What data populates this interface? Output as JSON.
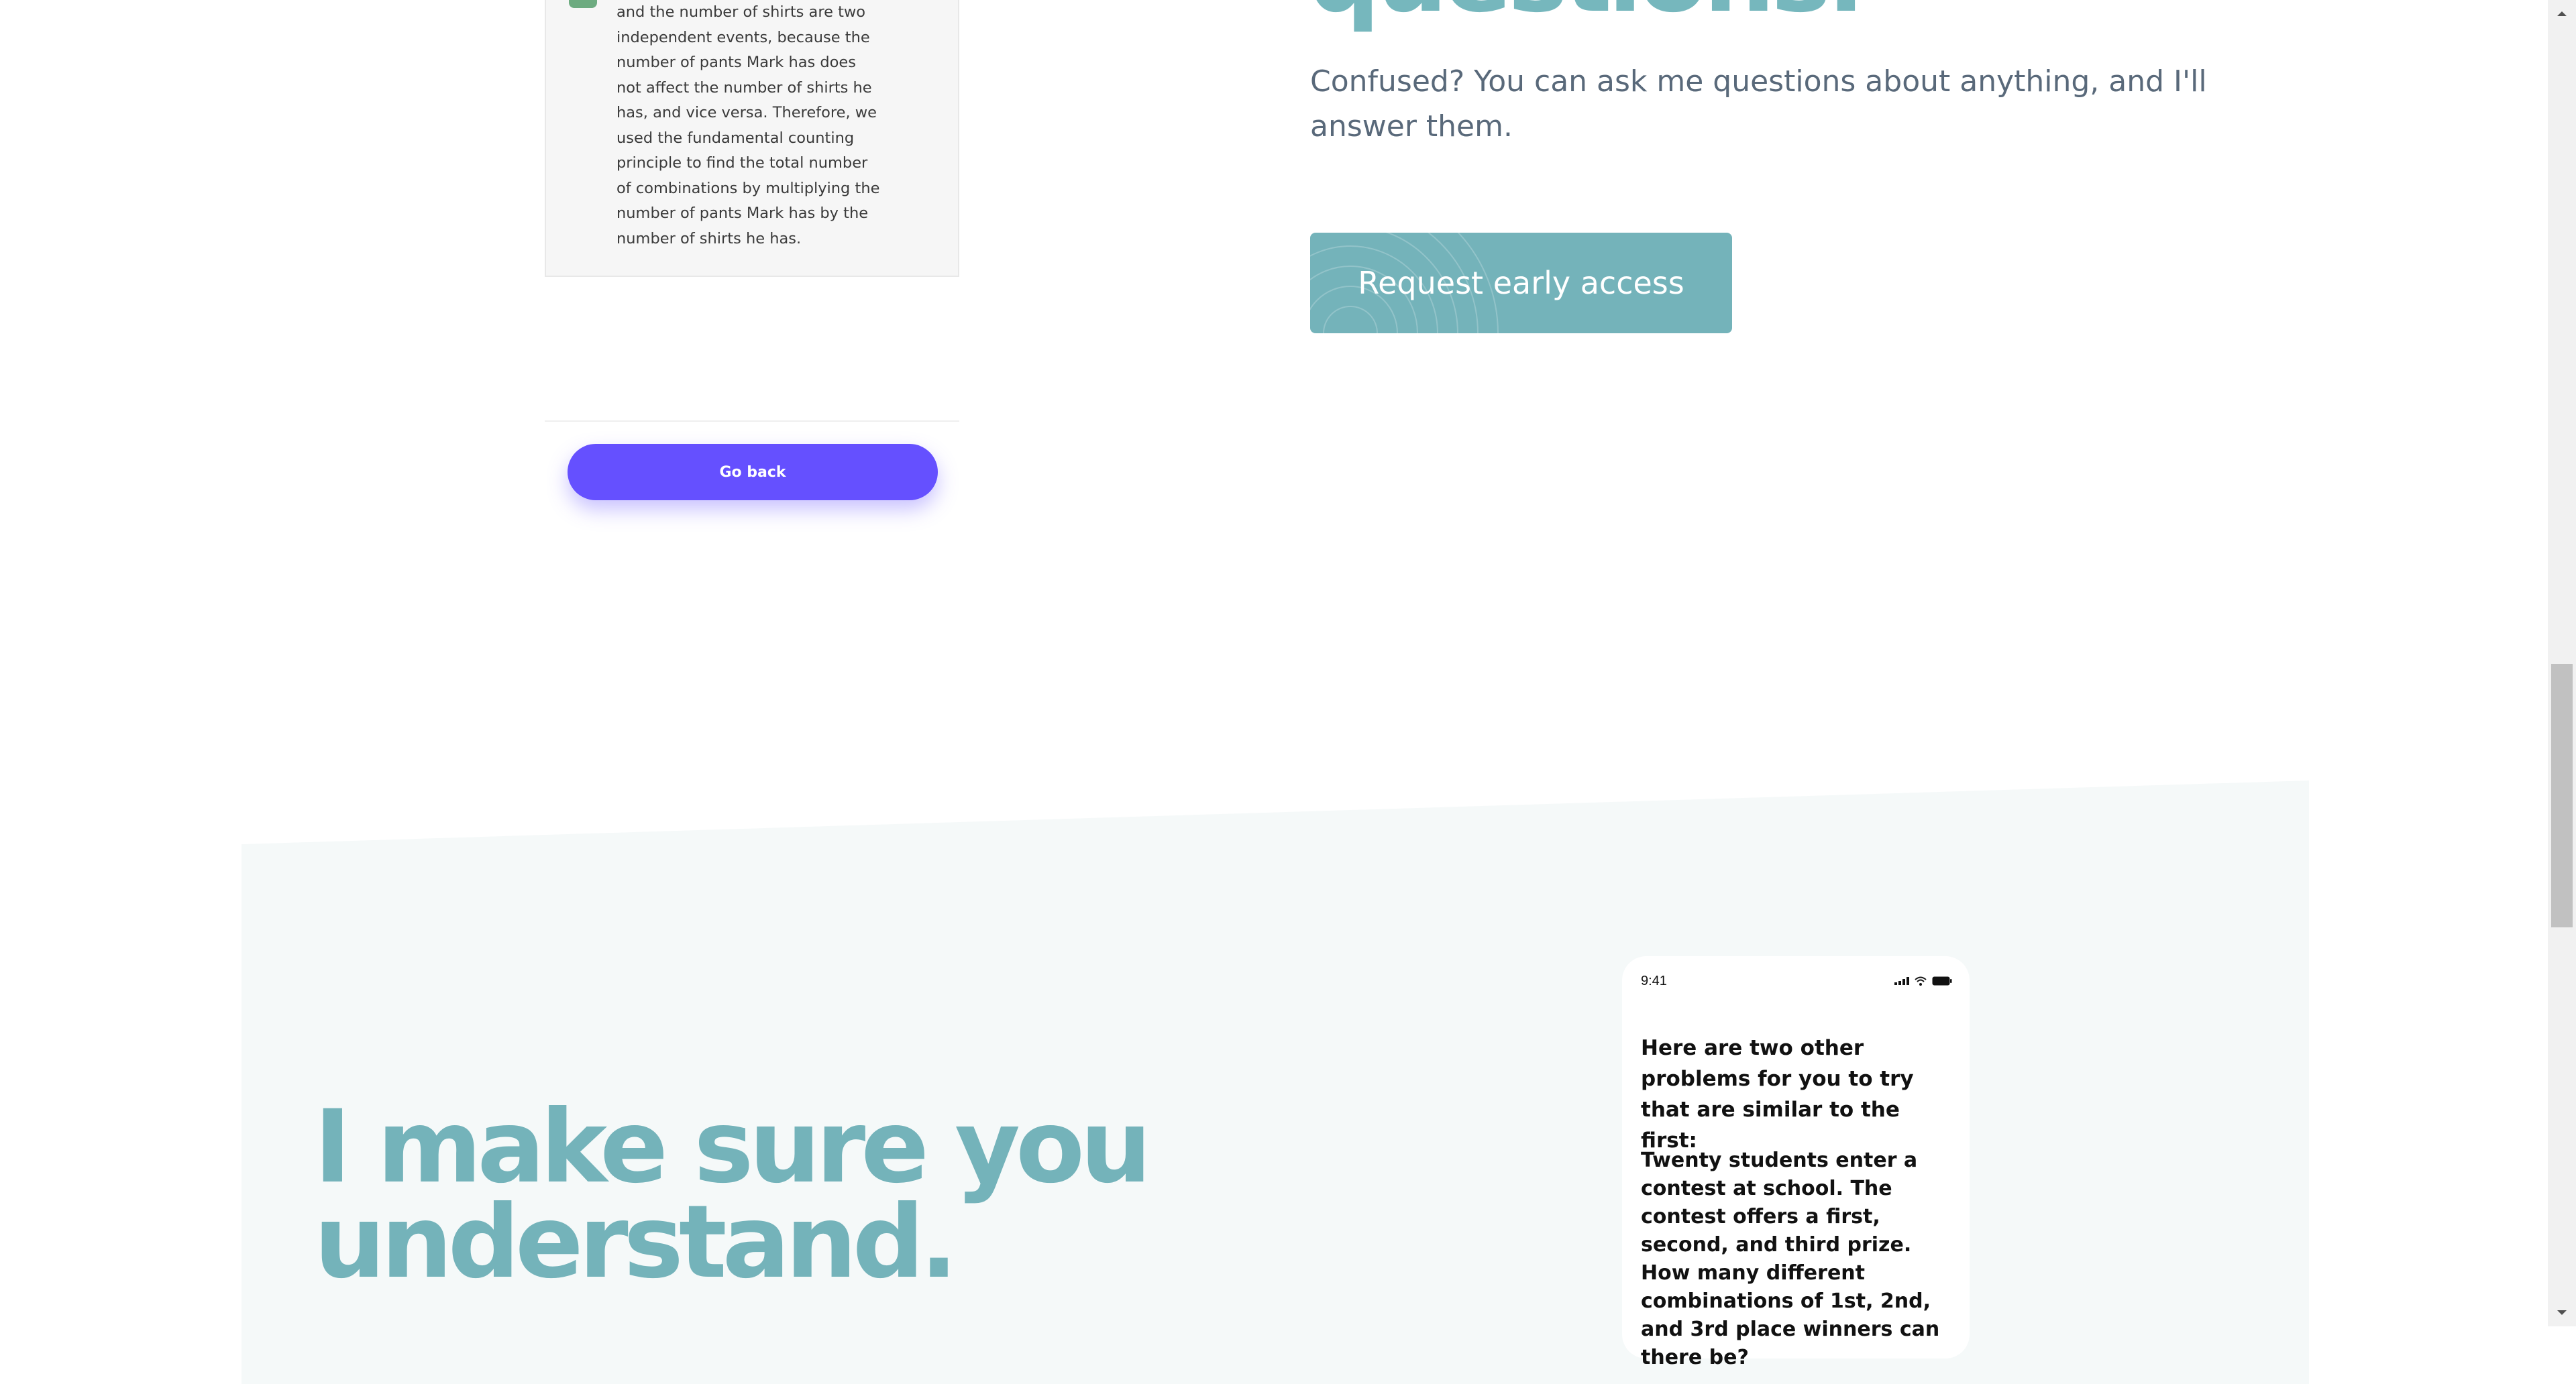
{
  "chat": {
    "text": "and the number of shirts are two independent events, because the number of pants Mark has does not affect the number of shirts he has, and vice versa. Therefore, we used the fundamental counting principle to find the total number of combinations by multiplying the number of pants Mark has by the number of shirts he has."
  },
  "go_back_label": "Go back",
  "hero": {
    "heading_partial": "questions.",
    "lead": "Confused? You can ask me questions about anything, and I'll answer them.",
    "cta_label": "Request early access"
  },
  "understand": {
    "heading": "I make sure you\nunderstand."
  },
  "phone": {
    "time": "9:41",
    "heading": "Here are two other problems for you to try that are similar to the first:",
    "body": "Twenty students enter a contest at school. The contest offers a first, second, and third prize. How many different combinations of 1st, 2nd, and 3rd place winners can there be?"
  },
  "colors": {
    "accent_teal": "#74b3ba",
    "button_purple": "#6550ff",
    "text_gray": "#59697a"
  }
}
